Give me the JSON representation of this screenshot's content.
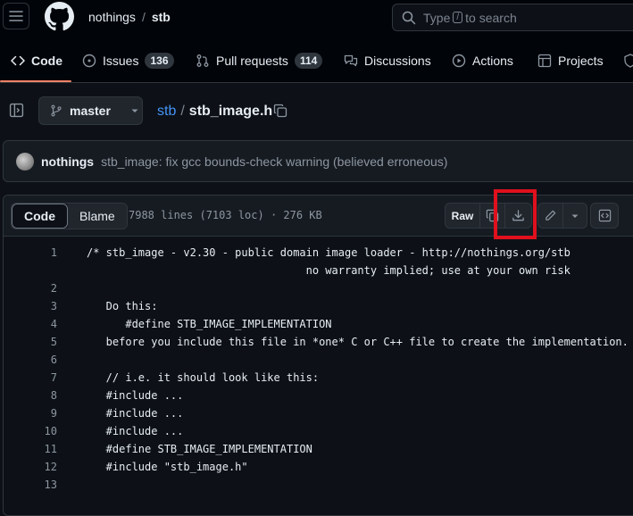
{
  "header": {
    "owner": "nothings",
    "separator": "/",
    "repo": "stb",
    "search_before": "Type",
    "search_key": "/",
    "search_after": "to search"
  },
  "tabs": [
    {
      "label": "Code",
      "icon": "code-icon"
    },
    {
      "label": "Issues",
      "count": "136",
      "icon": "issue-icon"
    },
    {
      "label": "Pull requests",
      "count": "114",
      "icon": "pull-request-icon"
    },
    {
      "label": "Discussions",
      "icon": "discussions-icon"
    },
    {
      "label": "Actions",
      "icon": "play-icon"
    },
    {
      "label": "Projects",
      "icon": "table-icon"
    }
  ],
  "breadcrumb": {
    "branch": "master",
    "repo": "stb",
    "separator": "/",
    "file": "stb_image.h"
  },
  "commit": {
    "author": "nothings",
    "message": "stb_image: fix gcc bounds-check warning (believed erroneous)"
  },
  "file_header": {
    "code_tab": "Code",
    "blame_tab": "Blame",
    "info": "7988 lines (7103 loc) · 276 KB",
    "raw_label": "Raw"
  },
  "colors": {
    "accent_underline": "#f78166",
    "link": "#4493f8",
    "highlight_box": "#e0101d"
  },
  "code_lines": [
    {
      "n": "1",
      "text": "/* stb_image - v2.30 - public domain image loader - http://nothings.org/stb"
    },
    {
      "n": "",
      "text": "                                  no warranty implied; use at your own risk"
    },
    {
      "n": "2",
      "text": ""
    },
    {
      "n": "3",
      "text": "   Do this:"
    },
    {
      "n": "4",
      "text": "      #define STB_IMAGE_IMPLEMENTATION"
    },
    {
      "n": "5",
      "text": "   before you include this file in *one* C or C++ file to create the implementation."
    },
    {
      "n": "6",
      "text": ""
    },
    {
      "n": "7",
      "text": "   // i.e. it should look like this:"
    },
    {
      "n": "8",
      "text": "   #include ..."
    },
    {
      "n": "9",
      "text": "   #include ..."
    },
    {
      "n": "10",
      "text": "   #include ..."
    },
    {
      "n": "11",
      "text": "   #define STB_IMAGE_IMPLEMENTATION"
    },
    {
      "n": "12",
      "text": "   #include \"stb_image.h\""
    },
    {
      "n": "13",
      "text": ""
    }
  ]
}
